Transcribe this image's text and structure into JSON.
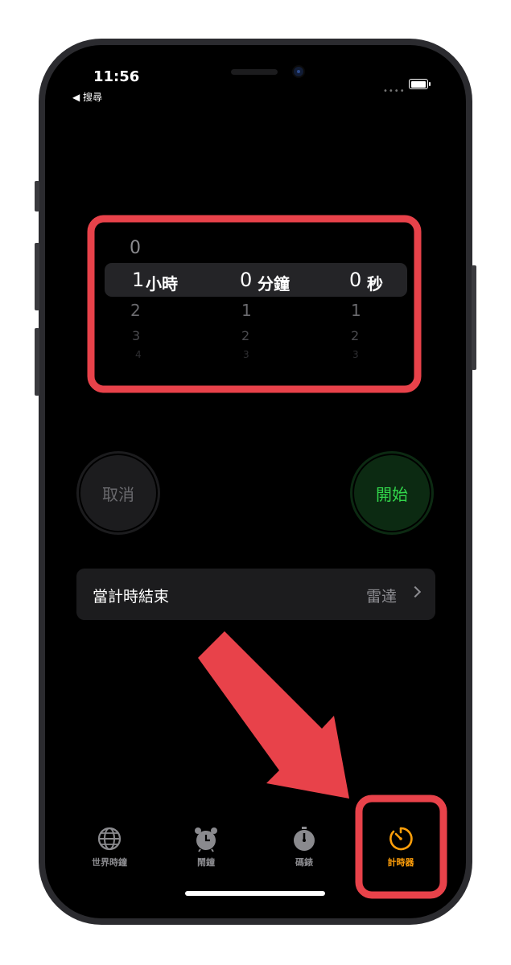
{
  "status_bar": {
    "time": "11:56",
    "back_label": "◀ 搜尋"
  },
  "picker": {
    "hours": {
      "above": [
        "0"
      ],
      "selected": "1",
      "unit": "小時",
      "below": [
        "2",
        "3",
        "4"
      ]
    },
    "minutes": {
      "selected": "0",
      "unit": "分鐘",
      "below": [
        "1",
        "2",
        "3"
      ]
    },
    "seconds": {
      "selected": "0",
      "unit": "秒",
      "below": [
        "1",
        "2",
        "3"
      ]
    }
  },
  "buttons": {
    "cancel": "取消",
    "start": "開始"
  },
  "when_timer_ends": {
    "label": "當計時結束",
    "value": "雷達"
  },
  "tabs": [
    {
      "label": "世界時鐘",
      "icon": "globe-icon",
      "active": false
    },
    {
      "label": "鬧鐘",
      "icon": "alarm-clock-icon",
      "active": false
    },
    {
      "label": "碼錶",
      "icon": "stopwatch-icon",
      "active": false
    },
    {
      "label": "計時器",
      "icon": "timer-icon",
      "active": true
    }
  ],
  "colors": {
    "accent_active_tab": "#ff9f0a",
    "start_green": "#32d74b",
    "annotation_red": "#e8424a"
  }
}
